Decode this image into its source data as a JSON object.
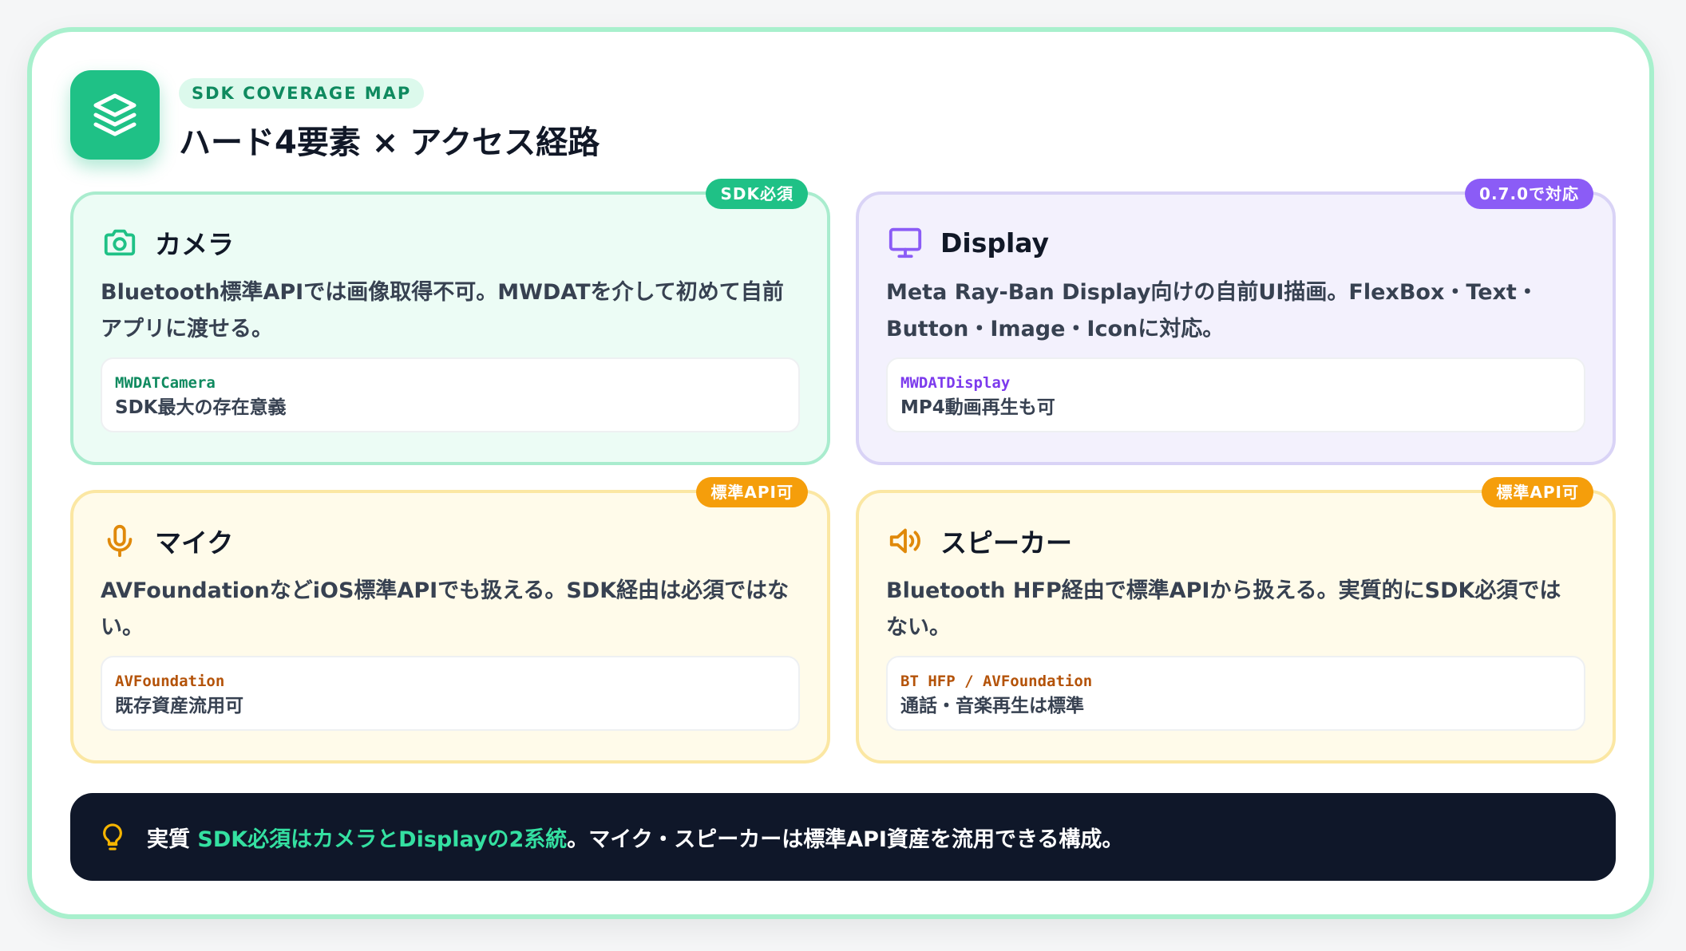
{
  "header": {
    "eyebrow": "SDK COVERAGE MAP",
    "title": "ハード4要素 × アクセス経路"
  },
  "cards": [
    {
      "title": "カメラ",
      "badge": "SDK必須",
      "description": "Bluetooth標準APIでは画像取得不可。MWDATを介して初めて自前アプリに渡せる。",
      "code": "MWDATCamera",
      "note": "SDK最大の存在意義",
      "icon": "camera-icon",
      "accent": "#1fc186"
    },
    {
      "title": "Display",
      "badge": "0.7.0で対応",
      "description": "Meta Ray-Ban Display向けの自前UI描画。FlexBox・Text・Button・Image・Iconに対応。",
      "code": "MWDATDisplay",
      "note": "MP4動画再生も可",
      "icon": "monitor-icon",
      "accent": "#8b5cf6"
    },
    {
      "title": "マイク",
      "badge": "標準API可",
      "description": "AVFoundationなどiOS標準APIでも扱える。SDK経由は必須ではない。",
      "code": "AVFoundation",
      "note": "既存資産流用可",
      "icon": "microphone-icon",
      "accent": "#f59e0b"
    },
    {
      "title": "スピーカー",
      "badge": "標準API可",
      "description": "Bluetooth HFP経由で標準APIから扱える。実質的にSDK必須ではない。",
      "code": "BT HFP / AVFoundation",
      "note": "通話・音楽再生は標準",
      "icon": "speaker-icon",
      "accent": "#f59e0b"
    }
  ],
  "summary": {
    "prefix": "実質 ",
    "highlight": "SDK必須はカメラとDisplayの2系統",
    "suffix": "。マイク・スピーカーは標準API資産を流用できる構成。",
    "icon": "lightbulb-icon",
    "highlight_color": "#34e0a1"
  },
  "colors": {
    "brand_green": "#1fc186",
    "purple": "#8b5cf6",
    "amber": "#f59e0b",
    "dark": "#0f1729"
  }
}
